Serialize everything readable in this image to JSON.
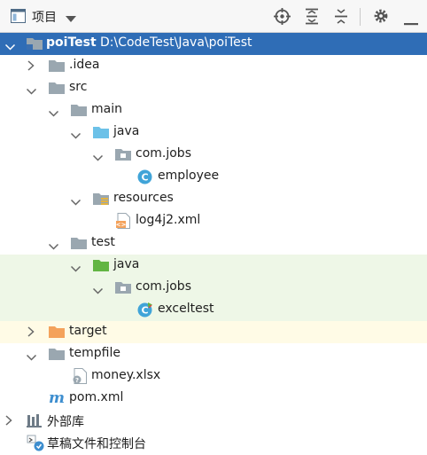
{
  "header": {
    "title": "项目"
  },
  "tree": {
    "root_name": "poiTest",
    "root_path": "D:\\CodeTest\\Java\\poiTest",
    "idea": ".idea",
    "src": "src",
    "main": "main",
    "main_java": "java",
    "main_pkg": "com.jobs",
    "employee": "employee",
    "resources": "resources",
    "log4j2": "log4j2.xml",
    "test": "test",
    "test_java": "java",
    "test_pkg": "com.jobs",
    "exceltest": "exceltest",
    "target": "target",
    "tempfile": "tempfile",
    "money": "money.xlsx",
    "pom": "pom.xml",
    "external_libs": "外部库",
    "scratches": "草稿文件和控制台"
  },
  "colors": {
    "selection": "#2f6db6",
    "folder_gray": "#9aa7b0",
    "source_blue": "#6cc1e8",
    "test_green": "#62b543",
    "excluded_orange": "#f4a25b",
    "class_blue": "#40a4d8"
  },
  "icons": {
    "project_view": "window-icon",
    "dropdown": "chevron-down-icon",
    "locate": "crosshair-icon",
    "expand_all": "expand-all-icon",
    "collapse_all": "collapse-all-icon",
    "settings": "gear-icon",
    "hide": "minimize-icon"
  }
}
